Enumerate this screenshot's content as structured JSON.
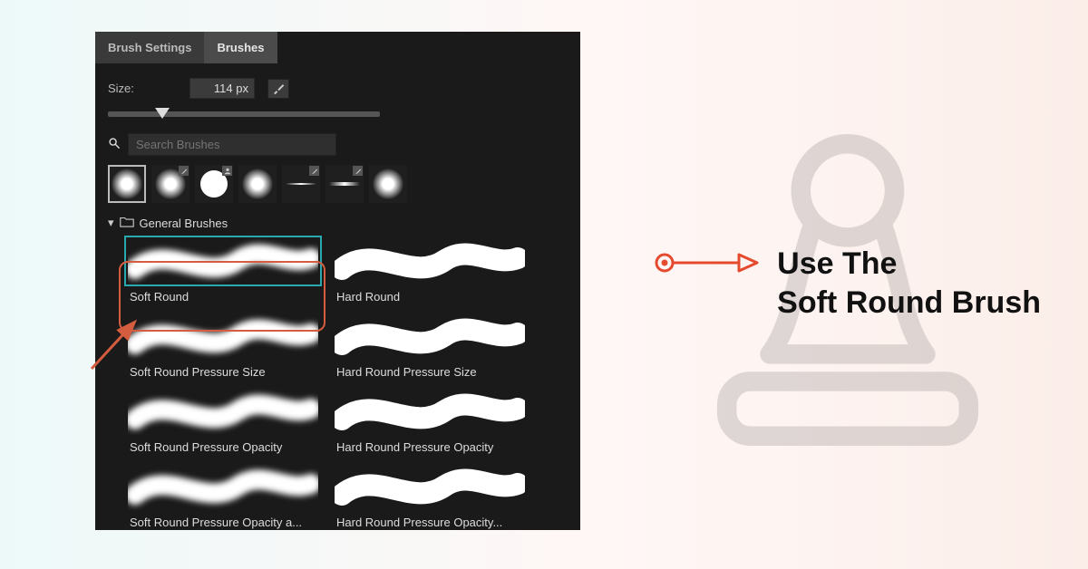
{
  "tabs": {
    "settings": "Brush Settings",
    "brushes": "Brushes"
  },
  "size": {
    "label": "Size:",
    "value": "114 px"
  },
  "search": {
    "placeholder": "Search Brushes"
  },
  "group": {
    "name": "General Brushes"
  },
  "brushes": [
    {
      "label": "Soft Round",
      "style": "soft"
    },
    {
      "label": "Hard Round",
      "style": "hard"
    },
    {
      "label": "Soft Round Pressure Size",
      "style": "soft"
    },
    {
      "label": "Hard Round Pressure Size",
      "style": "hard"
    },
    {
      "label": "Soft Round Pressure Opacity",
      "style": "soft"
    },
    {
      "label": "Hard Round Pressure Opacity",
      "style": "hard"
    },
    {
      "label": "Soft Round Pressure Opacity a...",
      "style": "soft"
    },
    {
      "label": "Hard Round Pressure Opacity...",
      "style": "hard"
    }
  ],
  "instruction": {
    "line1": "Use The",
    "line2": "Soft Round Brush"
  },
  "colors": {
    "accent": "#d45c3f",
    "teal": "#2aa8b0"
  }
}
